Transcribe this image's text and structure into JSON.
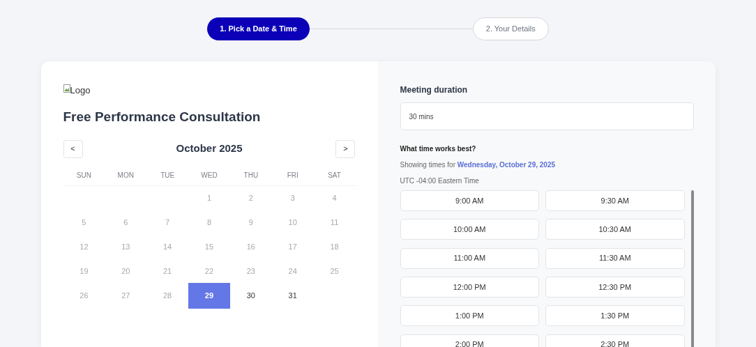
{
  "steps": [
    {
      "label": "1. Pick a Date & Time",
      "selected": true
    },
    {
      "label": "2. Your Details",
      "selected": false
    }
  ],
  "logo": {
    "alt": "Logo"
  },
  "title": "Free Performance Consultation",
  "calendar": {
    "prev": "<",
    "next": ">",
    "month": "October 2025",
    "weekdays": [
      "SUN",
      "MON",
      "TUE",
      "WED",
      "THU",
      "FRI",
      "SAT"
    ],
    "days": [
      {
        "kind": "blank"
      },
      {
        "kind": "blank"
      },
      {
        "kind": "blank"
      },
      {
        "kind": "day",
        "label": "1",
        "disabled": true,
        "selected": false
      },
      {
        "kind": "day",
        "label": "2",
        "disabled": true,
        "selected": false
      },
      {
        "kind": "day",
        "label": "3",
        "disabled": true,
        "selected": false
      },
      {
        "kind": "day",
        "label": "4",
        "disabled": true,
        "selected": false
      },
      {
        "kind": "day",
        "label": "5",
        "disabled": true,
        "selected": false
      },
      {
        "kind": "day",
        "label": "6",
        "disabled": true,
        "selected": false
      },
      {
        "kind": "day",
        "label": "7",
        "disabled": true,
        "selected": false
      },
      {
        "kind": "day",
        "label": "8",
        "disabled": true,
        "selected": false
      },
      {
        "kind": "day",
        "label": "9",
        "disabled": true,
        "selected": false
      },
      {
        "kind": "day",
        "label": "10",
        "disabled": true,
        "selected": false
      },
      {
        "kind": "day",
        "label": "11",
        "disabled": true,
        "selected": false
      },
      {
        "kind": "day",
        "label": "12",
        "disabled": true,
        "selected": false
      },
      {
        "kind": "day",
        "label": "13",
        "disabled": true,
        "selected": false
      },
      {
        "kind": "day",
        "label": "14",
        "disabled": true,
        "selected": false
      },
      {
        "kind": "day",
        "label": "15",
        "disabled": true,
        "selected": false
      },
      {
        "kind": "day",
        "label": "16",
        "disabled": true,
        "selected": false
      },
      {
        "kind": "day",
        "label": "17",
        "disabled": true,
        "selected": false
      },
      {
        "kind": "day",
        "label": "18",
        "disabled": true,
        "selected": false
      },
      {
        "kind": "day",
        "label": "19",
        "disabled": true,
        "selected": false
      },
      {
        "kind": "day",
        "label": "20",
        "disabled": true,
        "selected": false
      },
      {
        "kind": "day",
        "label": "21",
        "disabled": true,
        "selected": false
      },
      {
        "kind": "day",
        "label": "22",
        "disabled": true,
        "selected": false
      },
      {
        "kind": "day",
        "label": "23",
        "disabled": true,
        "selected": false
      },
      {
        "kind": "day",
        "label": "24",
        "disabled": true,
        "selected": false
      },
      {
        "kind": "day",
        "label": "25",
        "disabled": true,
        "selected": false
      },
      {
        "kind": "day",
        "label": "26",
        "disabled": true,
        "selected": false
      },
      {
        "kind": "day",
        "label": "27",
        "disabled": true,
        "selected": false
      },
      {
        "kind": "day",
        "label": "28",
        "disabled": true,
        "selected": false
      },
      {
        "kind": "day",
        "label": "29",
        "disabled": false,
        "selected": true
      },
      {
        "kind": "day",
        "label": "30",
        "disabled": false,
        "selected": false
      },
      {
        "kind": "day",
        "label": "31",
        "disabled": false,
        "selected": false
      }
    ]
  },
  "duration": {
    "label": "Meeting duration",
    "value": "30 mins"
  },
  "times": {
    "heading": "What time works best?",
    "showing": "Showing times for",
    "date": "Wednesday, October 29, 2025",
    "timezone": "UTC -04:00 Eastern Time",
    "slots": [
      "9:00 AM",
      "9:30 AM",
      "10:00 AM",
      "10:30 AM",
      "11:00 AM",
      "11:30 AM",
      "12:00 PM",
      "12:30 PM",
      "1:00 PM",
      "1:30 PM",
      "2:00 PM",
      "2:30 PM"
    ]
  }
}
